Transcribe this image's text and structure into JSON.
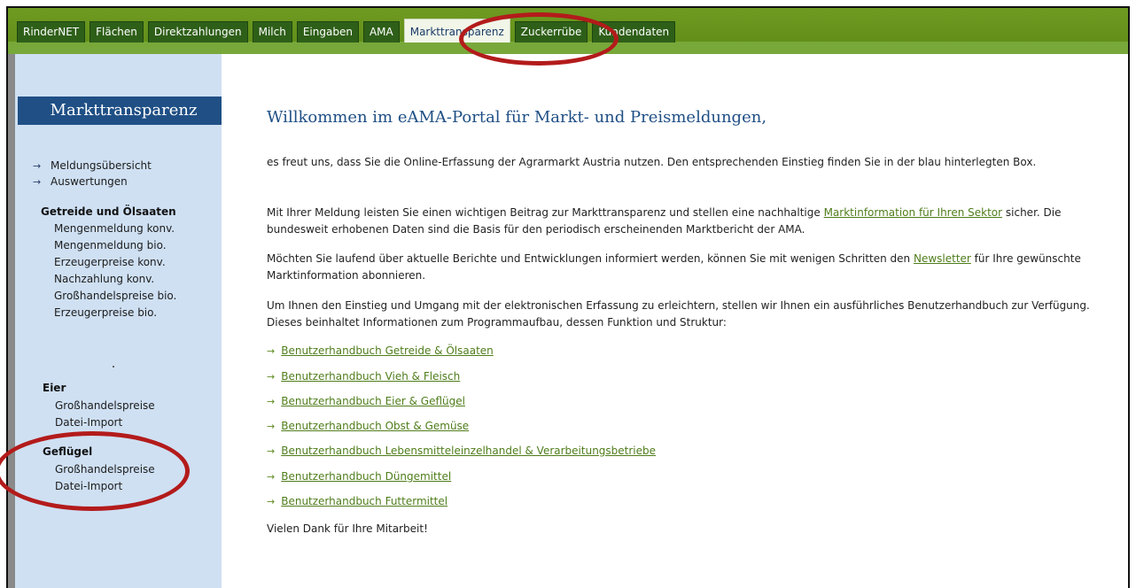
{
  "tabs": [
    "RinderNET",
    "Flächen",
    "Direktzahlungen",
    "Milch",
    "Eingaben",
    "AMA",
    "Markttransparenz",
    "Zuckerrübe",
    "Kundendaten"
  ],
  "active_tab": "Markttransparenz",
  "sidebar": {
    "title": "Markttransparenz",
    "top_links": [
      "Meldungsübersicht",
      "Auswertungen"
    ],
    "getreide": {
      "heading": "Getreide und Ölsaaten",
      "items": [
        "Mengenmeldung konv.",
        "Mengenmeldung bio.",
        "Erzeugerpreise konv.",
        "Nachzahlung konv.",
        "Großhandelspreise bio.",
        "Erzeugerpreise bio."
      ]
    },
    "eier": {
      "heading": "Eier",
      "items": [
        "Großhandelspreise",
        "Datei-Import"
      ]
    },
    "gefluegel": {
      "heading": "Geflügel",
      "items": [
        "Großhandelspreise",
        "Datei-Import"
      ]
    }
  },
  "main": {
    "title": "Willkommen im eAMA-Portal für Markt- und Preismeldungen,",
    "p1": "es freut uns, dass Sie die Online-Erfassung der Agrarmarkt Austria nutzen. Den entsprechenden Einstieg finden Sie in der blau hinterlegten Box.",
    "p2_before": "Mit Ihrer Meldung leisten Sie einen wichtigen Beitrag zur Markttransparenz und stellen eine nachhaltige ",
    "p2_link": "Marktinformation für Ihren Sektor",
    "p2_after": " sicher. Die bundesweit erhobenen Daten sind die Basis für den periodisch erscheinenden Marktbericht der AMA.",
    "p3_before": "Möchten Sie laufend über aktuelle Berichte und Entwicklungen informiert werden, können Sie mit wenigen Schritten den ",
    "p3_link": "Newsletter",
    "p3_after": " für Ihre gewünschte Marktinformation abonnieren.",
    "p4": "Um Ihnen den Einstieg und Umgang mit der elektronischen Erfassung zu erleichtern, stellen wir Ihnen ein ausführliches Benutzerhandbuch zur Verfügung. Dieses beinhaltet Informationen zum Programmaufbau, dessen Funktion und Struktur:",
    "manuals": [
      "Benutzerhandbuch Getreide & Ölsaaten",
      "Benutzerhandbuch Vieh & Fleisch",
      "Benutzerhandbuch Eier & Geflügel",
      "Benutzerhandbuch Obst & Gemüse",
      "Benutzerhandbuch Lebensmitteleinzelhandel & Verarbeitungsbetriebe",
      "Benutzerhandbuch Düngemittel",
      "Benutzerhandbuch Futtermittel"
    ],
    "closing": "Vielen Dank für Ihre Mitarbeit!"
  },
  "colors": {
    "green_bar": "#6f9b22",
    "tab": "#2e5f18",
    "sidebar_bg": "#cfe0f3",
    "title_blue": "#1f4f85",
    "link_green": "#4f7d1b",
    "annotation_red": "#b31b1b"
  },
  "icons": {
    "bullet": "arrow-right-icon"
  }
}
